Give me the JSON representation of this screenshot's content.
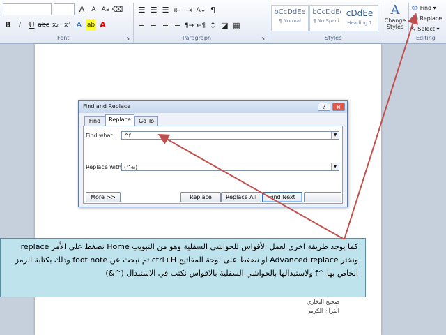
{
  "ribbon": {
    "font_group": "Font",
    "paragraph_group": "Paragraph",
    "styles_group": "Styles",
    "editing_group": "Editing",
    "bold": "B",
    "italic": "I",
    "underline": "U",
    "styles": [
      {
        "sample": "bCcDdEe",
        "name": "¶ Normal"
      },
      {
        "sample": "bCcDdEe",
        "name": "¶ No Spaci..."
      },
      {
        "sample": "cDdEe",
        "name": "Heading 1"
      }
    ],
    "change_styles": "Change Styles",
    "find": "Find",
    "replace": "Replace",
    "select": "Select"
  },
  "dialog": {
    "title": "Find and Replace",
    "help_btn": "?",
    "close_btn": "×",
    "tabs": [
      "Find",
      "Replace",
      "Go To"
    ],
    "find_label": "Find what:",
    "find_value": "^f",
    "replace_label": "Replace with:",
    "replace_value": "(^&)",
    "more_btn": "More >>",
    "replace_btn": "Replace",
    "replace_all_btn": "Replace All",
    "find_next_btn": "Find Next"
  },
  "document": {
    "lines": [
      "صحيح البخاري",
      "القرآن الكريم"
    ]
  },
  "callout": {
    "text": "كما يوجد طريقة اخرى لعمل الأقواس للحواشي السفلية وهو من التبويب Home نضغط على الأمر replace ونختر Advanced replace او نضغط على لوحة المفاتيح ctrl+H ثم نبحث عن foot note وذلك بكتابة الرمز الخاص بها ^f ولاستبدالها بالحواشي السفلية بالاقواس نكتب في الاستبدال (^&)"
  },
  "colors": {
    "arrow": "#c0504d",
    "callout_bg": "#bfe3ed",
    "ribbon_bg": "#e2e9f4"
  }
}
